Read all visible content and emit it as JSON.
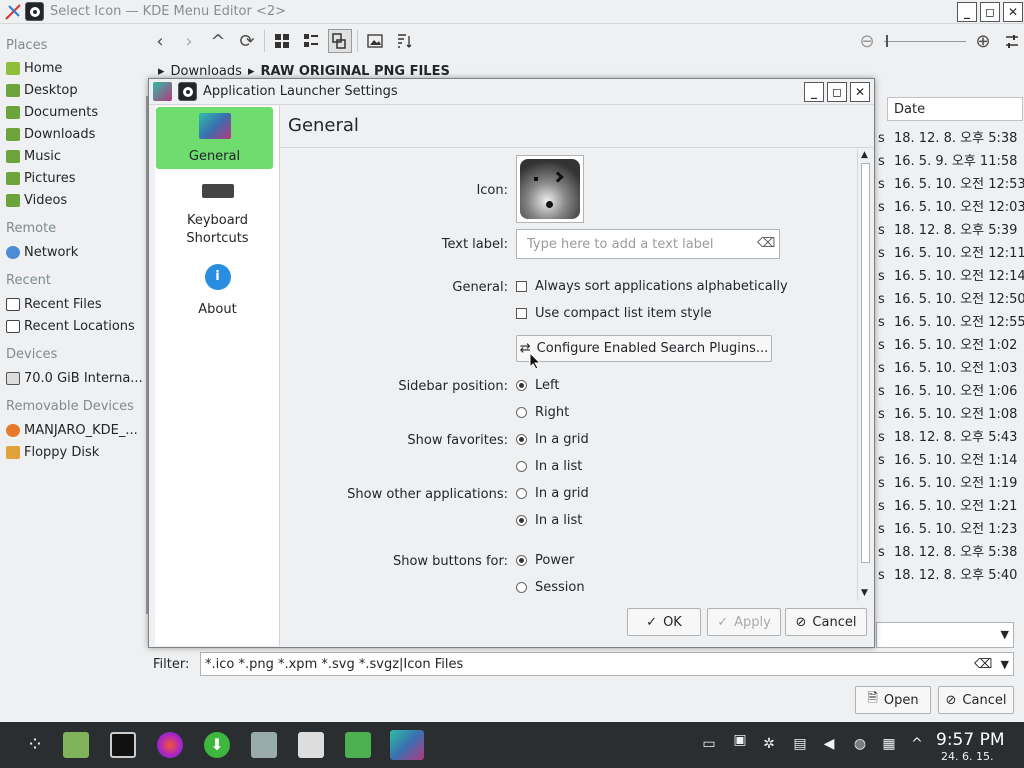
{
  "back_window": {
    "title": "Select Icon — KDE Menu Editor <2>",
    "breadcrumb": [
      "Downloads",
      "RAW ORIGINAL PNG FILES"
    ],
    "places": {
      "sections": [
        {
          "heading": "Places",
          "items": [
            "Home",
            "Desktop",
            "Documents",
            "Downloads",
            "Music",
            "Pictures",
            "Videos"
          ]
        },
        {
          "heading": "Remote",
          "items": [
            "Network"
          ]
        },
        {
          "heading": "Recent",
          "items": [
            "Recent Files",
            "Recent Locations"
          ]
        },
        {
          "heading": "Devices",
          "items": [
            "70.0 GiB Interna..."
          ]
        },
        {
          "heading": "Removable Devices",
          "items": [
            "MANJARO_KDE_...",
            "Floppy Disk"
          ]
        }
      ]
    },
    "list": {
      "date_header": "Date",
      "dates": [
        "18. 12. 8. 오후 5:38",
        "16. 5. 9. 오후 11:58",
        "16. 5. 10. 오전 12:53",
        "16. 5. 10. 오전 12:03",
        "18. 12. 8. 오후 5:39",
        "16. 5. 10. 오전 12:11",
        "16. 5. 10. 오전 12:14",
        "16. 5. 10. 오전 12:50",
        "16. 5. 10. 오전 12:55",
        "16. 5. 10. 오전 1:02",
        "16. 5. 10. 오전 1:03",
        "16. 5. 10. 오전 1:06",
        "16. 5. 10. 오전 1:08",
        "18. 12. 8. 오후 5:43",
        "16. 5. 10. 오전 1:14",
        "16. 5. 10. 오전 1:19",
        "16. 5. 10. 오전 1:21",
        "16. 5. 10. 오전 1:23",
        "18. 12. 8. 오후 5:38",
        "18. 12. 8. 오후 5:40"
      ],
      "col_marker": "s"
    },
    "filter_label": "Filter:",
    "filter_value": "*.ico *.png *.xpm *.svg *.svgz|Icon Files",
    "open_label": "Open",
    "cancel_label": "Cancel"
  },
  "dialog": {
    "title": "Application Launcher Settings",
    "sidebar": [
      {
        "label": "General",
        "active": true
      },
      {
        "label": "Keyboard Shortcuts",
        "active": false
      },
      {
        "label": "About",
        "active": false
      }
    ],
    "page_title": "General",
    "icon_label": "Icon:",
    "text_label_label": "Text label:",
    "text_label_placeholder": "Type here to add a text label",
    "general_label": "General:",
    "always_sort": "Always sort applications alphabetically",
    "compact_list": "Use compact list item style",
    "configure_plugins": "Configure Enabled Search Plugins...",
    "sidebar_position_label": "Sidebar position:",
    "sidebar_left": "Left",
    "sidebar_right": "Right",
    "show_favorites_label": "Show favorites:",
    "fav_grid": "In a grid",
    "fav_list": "In a list",
    "show_other_label": "Show other applications:",
    "other_grid": "In a grid",
    "other_list": "In a list",
    "show_buttons_label": "Show buttons for:",
    "buttons_power": "Power",
    "buttons_session": "Session",
    "ok_label": "OK",
    "apply_label": "Apply",
    "cancel_label": "Cancel"
  },
  "taskbar": {
    "time": "9:57 PM",
    "date": "24. 6. 15."
  },
  "colors": {
    "accent_green": "#6fdc6f",
    "taskbar": "#2b2e31"
  }
}
